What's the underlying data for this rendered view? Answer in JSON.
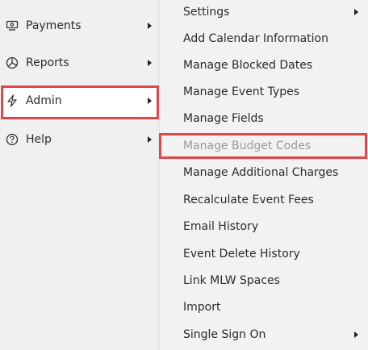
{
  "left_menu": {
    "items": [
      {
        "label": "Payments",
        "icon": "payments-icon"
      },
      {
        "label": "Reports",
        "icon": "reports-icon"
      },
      {
        "label": "Admin",
        "icon": "lightning-icon"
      },
      {
        "label": "Help",
        "icon": "help-circle-icon"
      }
    ]
  },
  "submenu": {
    "items": [
      {
        "label": "Settings"
      },
      {
        "label": "Add Calendar Information"
      },
      {
        "label": "Manage Blocked Dates"
      },
      {
        "label": "Manage Event Types"
      },
      {
        "label": "Manage Fields"
      },
      {
        "label": "Manage Budget Codes"
      },
      {
        "label": "Manage Additional Charges"
      },
      {
        "label": "Recalculate Event Fees"
      },
      {
        "label": "Email History"
      },
      {
        "label": "Event Delete History"
      },
      {
        "label": "Link MLW Spaces"
      },
      {
        "label": "Import"
      },
      {
        "label": "Single Sign On"
      }
    ]
  },
  "colors": {
    "highlight_border": "#e0474c",
    "disabled_text": "#9a9a9a",
    "menu_background": "#f0f0f0",
    "active_item_background": "#ffffff"
  }
}
